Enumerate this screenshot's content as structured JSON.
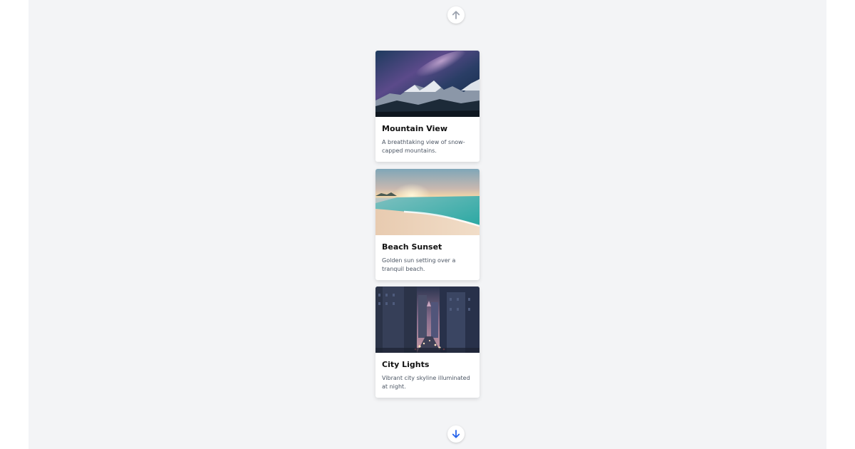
{
  "navigation": {
    "up_icon": "arrow-up-icon",
    "down_icon": "arrow-down-icon",
    "up_color": "#9ca3af",
    "down_color": "#2563eb"
  },
  "cards": [
    {
      "title": "Mountain View",
      "description": "A breathtaking view of snow-capped mountains.",
      "image": "mountain-night-sky-image"
    },
    {
      "title": "Beach Sunset",
      "description": "Golden sun setting over a tranquil beach.",
      "image": "beach-sunset-image"
    },
    {
      "title": "City Lights",
      "description": "Vibrant city skyline illuminated at night.",
      "image": "city-street-night-image"
    }
  ]
}
